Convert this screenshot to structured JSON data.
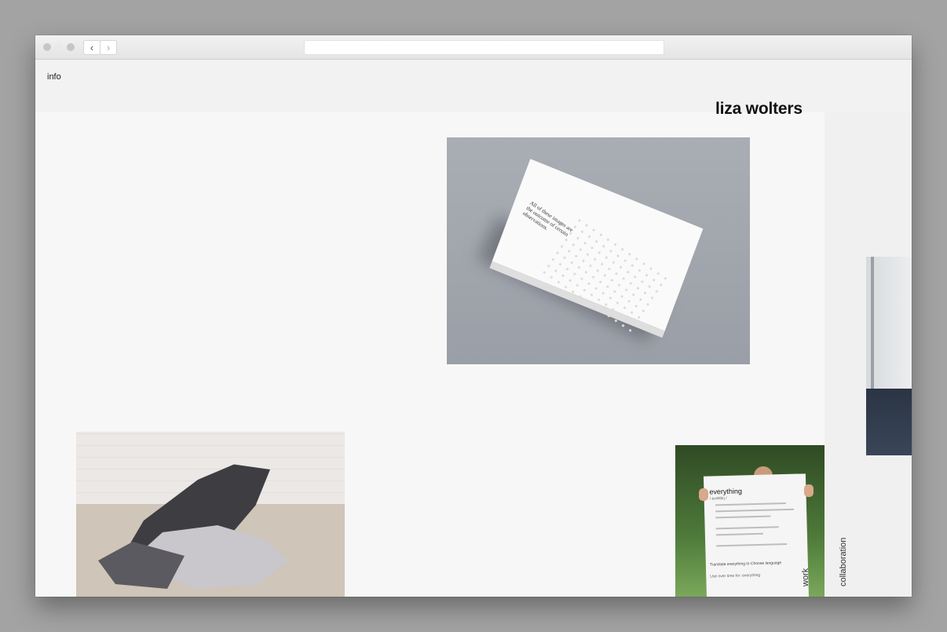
{
  "browser": {
    "back_icon": "chevron-left-icon",
    "forward_icon": "chevron-right-icon",
    "url": ""
  },
  "nav": {
    "info": "info",
    "work": "work",
    "collaboration": "collaboration"
  },
  "site": {
    "title": "liza wolters"
  },
  "images": {
    "book": {
      "cover_text": "All of these images are the outcome of certain observations."
    },
    "poster": {
      "title": "everything",
      "subtitle": "/ evrēθiŋ /",
      "translate": "Translate everything to Choose language",
      "use": "Use over time for: everything"
    }
  }
}
